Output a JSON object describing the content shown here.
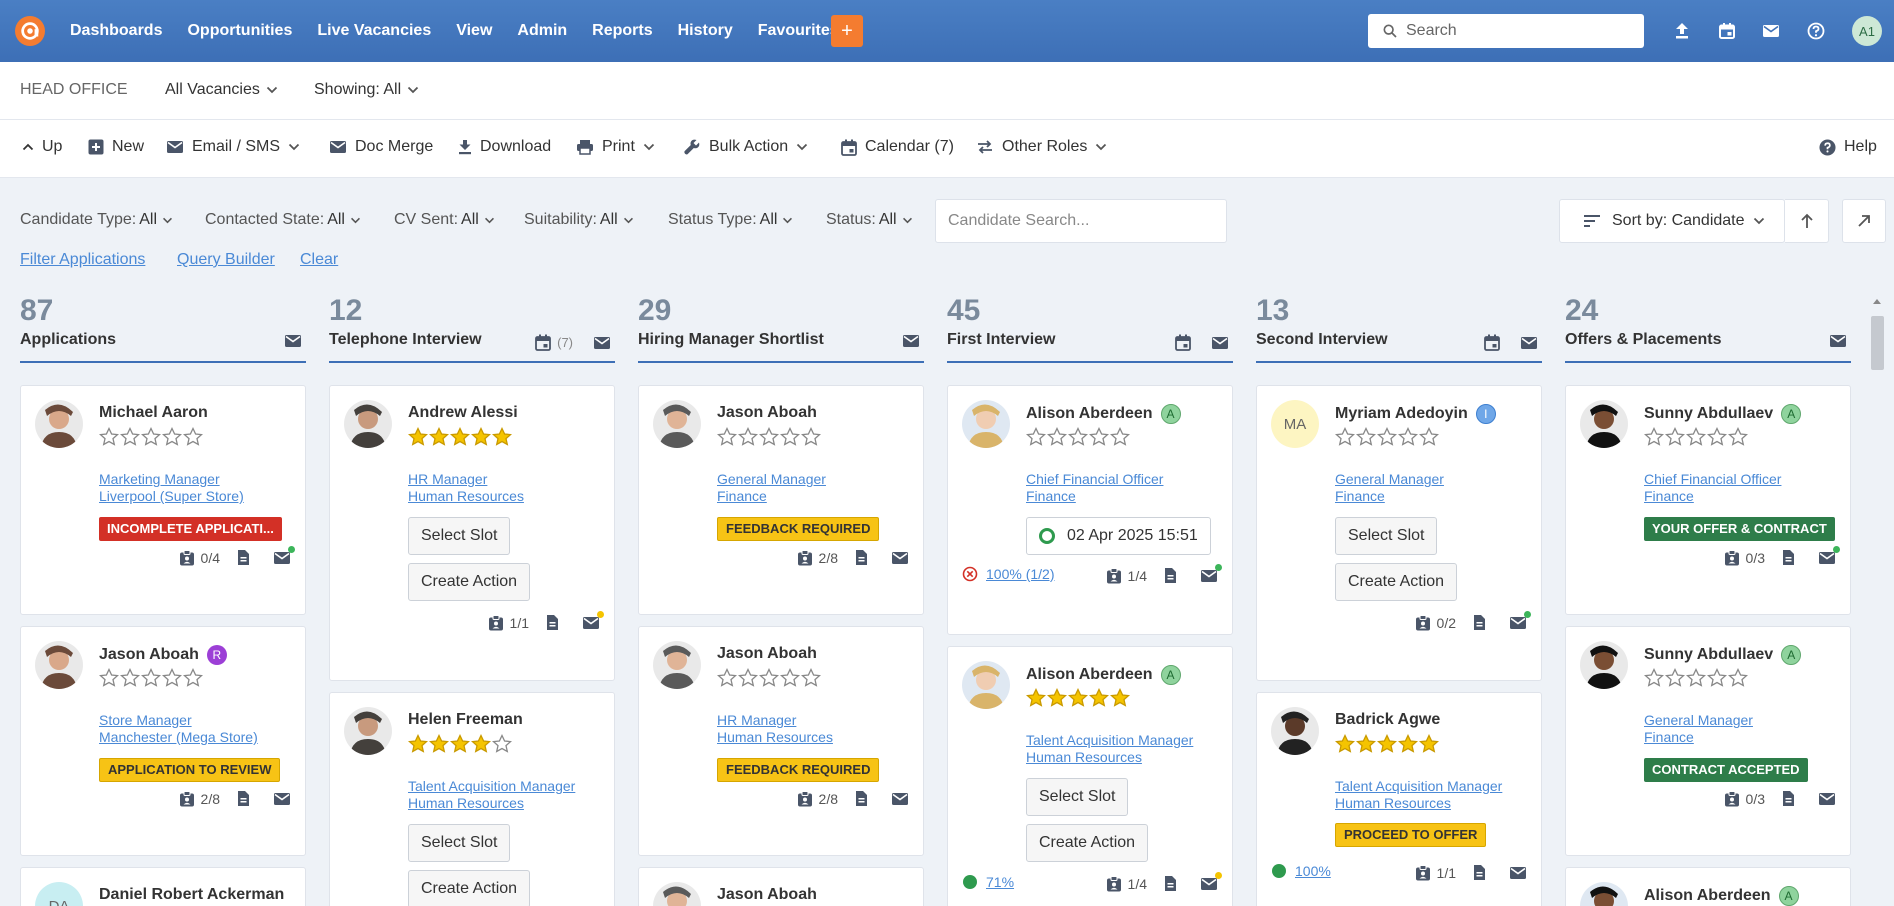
{
  "nav": {
    "items": [
      "Dashboards",
      "Opportunities",
      "Live Vacancies",
      "View",
      "Admin",
      "Reports",
      "History",
      "Favourites"
    ],
    "plus_label": "+",
    "search_placeholder": "Search",
    "avatar": "A1"
  },
  "subbar": {
    "office": "HEAD OFFICE",
    "vacancies": "All Vacancies",
    "showing": "Showing: All"
  },
  "toolbar": {
    "up": "Up",
    "new": "New",
    "email_sms": "Email / SMS",
    "doc_merge": "Doc Merge",
    "download": "Download",
    "print": "Print",
    "bulk_action": "Bulk Action",
    "calendar": "Calendar (7)",
    "other_roles": "Other Roles",
    "help": "Help"
  },
  "filters": {
    "candidate_type": {
      "label": "Candidate Type:",
      "value": "All"
    },
    "contacted_state": {
      "label": "Contacted State:",
      "value": "All"
    },
    "cv_sent": {
      "label": "CV Sent:",
      "value": "All"
    },
    "suitability": {
      "label": "Suitability:",
      "value": "All"
    },
    "status_type": {
      "label": "Status Type:",
      "value": "All"
    },
    "status": {
      "label": "Status:",
      "value": "All"
    },
    "candidate_search_placeholder": "Candidate Search...",
    "sort": "Sort by: Candidate",
    "filter_applications": "Filter Applications",
    "query_builder": "Query Builder",
    "clear": "Clear"
  },
  "columns": [
    {
      "count": "87",
      "title": "Applications",
      "calendar_count": "",
      "cards": [
        {
          "name": "Michael Aaron",
          "badge": "",
          "stars": 0,
          "role": "Marketing Manager",
          "dept": "Liverpool (Super Store)",
          "status": "INCOMPLETE APPLICATI...",
          "status_color": "red",
          "foot_count": "0/4",
          "mail_dot": "#3cb55a"
        },
        {
          "name": "Jason Aboah",
          "badge": "R",
          "stars": 0,
          "role": "Store Manager",
          "dept": "Manchester (Mega Store)",
          "status": "APPLICATION TO REVIEW",
          "status_color": "yellow",
          "foot_count": "2/8",
          "mail_dot": ""
        },
        {
          "name": "Daniel Robert Ackerman",
          "initials": "DA"
        }
      ]
    },
    {
      "count": "12",
      "title": "Telephone Interview",
      "calendar_count": "(7)",
      "cards": [
        {
          "name": "Andrew Alessi",
          "badge": "",
          "stars": 5,
          "role": "HR Manager",
          "dept": "Human Resources",
          "btn1": "Select Slot",
          "btn2": "Create Action",
          "foot_count": "1/1",
          "mail_dot": "#f5c400"
        },
        {
          "name": "Helen Freeman",
          "badge": "",
          "stars": 4,
          "role": "Talent Acquisition Manager",
          "dept": "Human Resources",
          "btn1": "Select Slot",
          "btn2": "Create Action"
        }
      ]
    },
    {
      "count": "29",
      "title": "Hiring Manager Shortlist",
      "calendar_count": "",
      "cards": [
        {
          "name": "Jason Aboah",
          "badge": "",
          "stars": 0,
          "role": "General Manager",
          "dept": "Finance",
          "status": "FEEDBACK REQUIRED",
          "status_color": "yellow",
          "foot_count": "2/8",
          "mail_dot": ""
        },
        {
          "name": "Jason Aboah",
          "badge": "",
          "stars": 0,
          "role": "HR Manager",
          "dept": "Human Resources",
          "status": "FEEDBACK REQUIRED",
          "status_color": "yellow",
          "foot_count": "2/8",
          "mail_dot": ""
        },
        {
          "name": "Jason Aboah"
        }
      ]
    },
    {
      "count": "45",
      "title": "First Interview",
      "calendar_count": "",
      "cards": [
        {
          "name": "Alison Aberdeen",
          "badge": "A",
          "stars": 0,
          "role": "Chief Financial Officer",
          "dept": "Finance",
          "date": "02 Apr 2025 15:51",
          "pct": "100% (1/2)",
          "foot_count": "1/4",
          "mail_dot": "#3cb55a"
        },
        {
          "name": "Alison Aberdeen",
          "badge": "A",
          "stars": 5,
          "role": "Talent Acquisition Manager",
          "dept": "Human Resources",
          "btn1": "Select Slot",
          "btn2": "Create Action",
          "pct": "71%",
          "foot_count": "1/4",
          "mail_dot": "#f5c400"
        }
      ]
    },
    {
      "count": "13",
      "title": "Second Interview",
      "calendar_count": "",
      "cards": [
        {
          "name": "Myriam Adedoyin",
          "badge": "I",
          "initials": "MA",
          "stars": 0,
          "role": "General Manager",
          "dept": "Finance",
          "btn1": "Select Slot",
          "btn2": "Create Action",
          "foot_count": "0/2",
          "mail_dot": "#3cb55a"
        },
        {
          "name": "Badrick Agwe",
          "badge": "",
          "stars": 5,
          "role": "Talent Acquisition Manager",
          "dept": "Human Resources",
          "status": "PROCEED TO OFFER",
          "status_color": "yellow",
          "pct": "100%",
          "foot_count": "1/1",
          "mail_dot": ""
        }
      ]
    },
    {
      "count": "24",
      "title": "Offers & Placements",
      "calendar_count": "",
      "cards": [
        {
          "name": "Sunny Abdullaev",
          "badge": "A",
          "stars": 0,
          "role": "Chief Financial Officer",
          "dept": "Finance",
          "status": "YOUR OFFER & CONTRACT",
          "status_color": "green",
          "foot_count": "0/3",
          "mail_dot": "#3cb55a"
        },
        {
          "name": "Sunny Abdullaev",
          "badge": "A",
          "stars": 0,
          "role": "General Manager",
          "dept": "Finance",
          "status": "CONTRACT ACCEPTED",
          "status_color": "green",
          "foot_count": "0/3",
          "mail_dot": ""
        },
        {
          "name": "Alison Aberdeen",
          "badge": "A"
        }
      ]
    }
  ],
  "colors": {
    "nav": "#3d6fb6",
    "accent": "#f47c30",
    "link": "#4a89d6",
    "star": "#f5c400"
  }
}
